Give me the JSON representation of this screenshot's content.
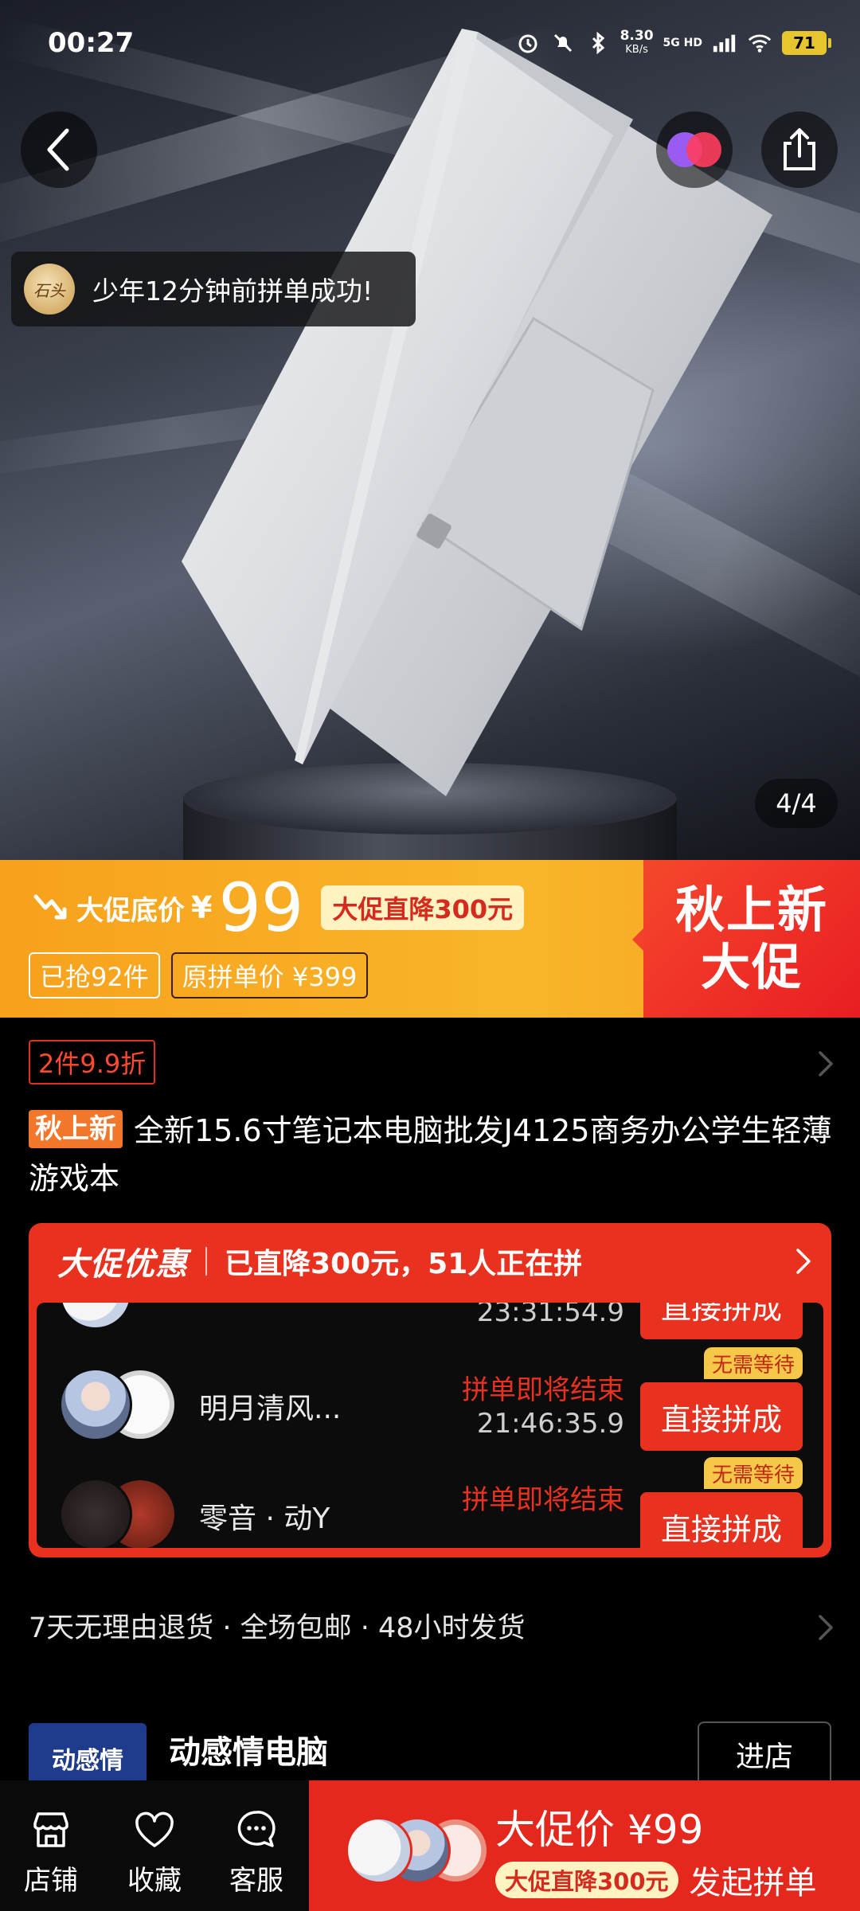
{
  "status_bar": {
    "time": "00:27",
    "net_speed": "8.30",
    "net_unit": "KB/s",
    "network": "5G HD",
    "battery": "71"
  },
  "hero": {
    "toast_text": "少年12分钟前拼单成功!",
    "toast_avatar_text": "石头",
    "page_indicator": "4/4"
  },
  "promo": {
    "price_label": "大促底价",
    "currency": "¥",
    "price": "99",
    "drop_tag": "大促直降300元",
    "sold": "已抢92件",
    "original_price": "原拼单价 ¥399",
    "badge_line1": "秋上新",
    "badge_line2": "大促"
  },
  "product": {
    "discount_tag": "2件9.9折",
    "title_badge": "秋上新",
    "title": "全新15.6寸笔记本电脑批发J4125商务办公学生轻薄游戏本"
  },
  "group_buy": {
    "brand": "大促优惠",
    "info": "已直降300元，51人正在拼",
    "rows": [
      {
        "name": "\"",
        "end_text": "",
        "time": "23:31:54.9",
        "button": "直接拼成",
        "badge": ""
      },
      {
        "name": "明月清风...",
        "end_text": "拼单即将结束",
        "time": "21:46:35.9",
        "button": "直接拼成",
        "badge": "无需等待"
      },
      {
        "name": "零音 · 动Y",
        "end_text": "拼单即将结束",
        "time": "",
        "button": "直接拼成",
        "badge": "无需等待"
      }
    ]
  },
  "services": {
    "text": "7天无理由退货 · 全场包邮 · 48小时发货"
  },
  "store": {
    "logo_text": "动感情",
    "name": "动感情电脑",
    "enter_button": "进店"
  },
  "bottom_bar": {
    "tab_store": "店铺",
    "tab_favorite": "收藏",
    "tab_service": "客服",
    "buy_price": "大促价 ¥99",
    "buy_drop": "大促直降300元",
    "buy_action": "发起拼单"
  },
  "colors": {
    "accent_red": "#e8321f",
    "promo_orange": "#f9b52a",
    "drop_tag_bg": "#fff3c2"
  }
}
